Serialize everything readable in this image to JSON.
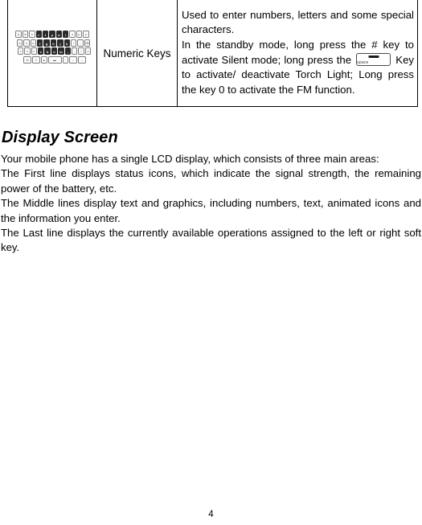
{
  "document": {
    "page_number": "4"
  },
  "table": {
    "rows": [
      {
        "image_name": "numeric-keypad-illustration",
        "keypad": {
          "rows": [
            [
              "q",
              "w",
              "e",
              "r",
              "t",
              "y",
              "u",
              "i",
              "o",
              "p"
            ],
            [
              "a",
              "s",
              "d",
              "f",
              "g",
              "h",
              "j",
              "k",
              "l",
              "⌫"
            ],
            [
              "z",
              "x",
              "c",
              "v",
              "b",
              "n",
              "m",
              ".",
              ",",
              "↲"
            ],
            [
              "fn",
              "⇧",
              "⚙",
              "space",
              "↕",
              "←",
              "→"
            ]
          ],
          "dark_keys_row1": [
            3,
            4,
            5,
            6,
            7
          ],
          "dark_keys_row2": [
            3,
            4,
            5,
            6,
            7
          ],
          "dark_keys_row3": [
            3,
            4,
            5,
            6,
            7
          ]
        },
        "label": "Numeric Keys",
        "description_paragraphs": [
          "Used to enter numbers, letters and some special characters.",
          "In the standby mode, long press the # key to activate Silent mode; long press the ",
          " Key to activate/ deactivate Torch Light; Long press the key 0 to activate the FM function."
        ],
        "inline_key": {
          "name": "space-key-glyph",
          "label": "space"
        }
      }
    ]
  },
  "section": {
    "heading": "Display Screen",
    "paragraphs": [
      "Your mobile phone has a single LCD display, which consists of three main areas:",
      "The First line displays status icons, which indicate the signal strength, the remaining power of the battery, etc.",
      "The Middle lines display text and graphics, including numbers, text, animated icons and the information you enter.",
      "The Last line displays the currently available operations assigned to the left or right soft key."
    ]
  }
}
